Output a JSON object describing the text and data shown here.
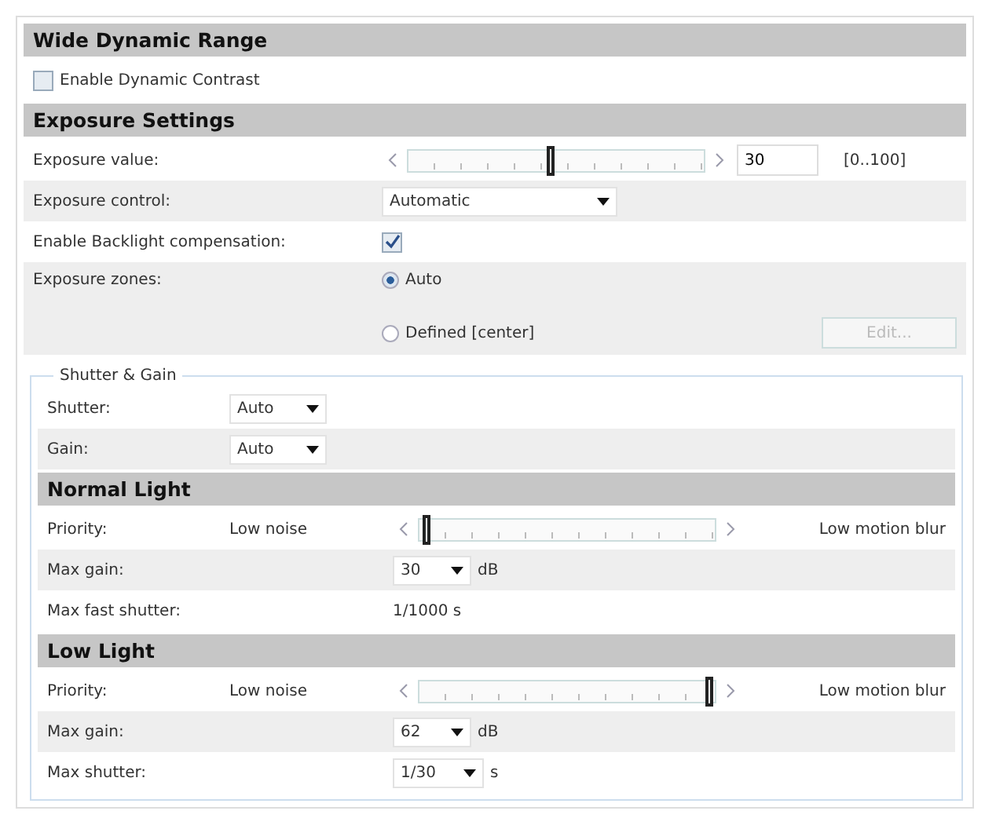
{
  "sections": [
    {
      "title": "Wide Dynamic Range",
      "rows": [
        {
          "kind": "checkbox",
          "label": "Enable Dynamic Contrast",
          "checked": false
        }
      ]
    },
    {
      "title": "Exposure Settings",
      "rows": [
        {
          "kind": "slider",
          "label": "Exposure value:",
          "level": 0.48,
          "value": "30",
          "range": "[0..100]"
        },
        {
          "kind": "select",
          "label": "Exposure control:",
          "value": "Automatic"
        },
        {
          "kind": "labeled_checkbox",
          "label": "Enable Backlight compensation:",
          "checked": true
        },
        {
          "kind": "radios",
          "label": "Exposure zones:",
          "options": [
            {
              "label": "Auto",
              "selected": true
            },
            {
              "label": "Defined [center]",
              "selected": false
            }
          ],
          "button": {
            "label": "Edit...",
            "disabled": true
          }
        }
      ]
    }
  ],
  "group": {
    "legend": "Shutter & Gain",
    "rows": [
      {
        "kind": "select",
        "label": "Shutter:",
        "value": "Auto"
      },
      {
        "kind": "select",
        "label": "Gain:",
        "value": "Auto"
      }
    ],
    "sections": [
      {
        "title": "Normal Light",
        "rows": [
          {
            "kind": "priority",
            "label": "Priority:",
            "low": "Low noise",
            "high": "Low motion blur",
            "level": 0.02
          },
          {
            "kind": "select",
            "label": "Max gain:",
            "value": "30",
            "unit": "dB"
          },
          {
            "kind": "text",
            "label": "Max fast shutter:",
            "value": "1/1000 s"
          }
        ]
      },
      {
        "title": "Low Light",
        "rows": [
          {
            "kind": "priority",
            "label": "Priority:",
            "low": "Low noise",
            "high": "Low motion blur",
            "level": 0.98
          },
          {
            "kind": "select",
            "label": "Max gain:",
            "value": "62",
            "unit": "dB"
          },
          {
            "kind": "select",
            "label": "Max shutter:",
            "value": "1/30",
            "unit": "s"
          }
        ]
      }
    ]
  }
}
